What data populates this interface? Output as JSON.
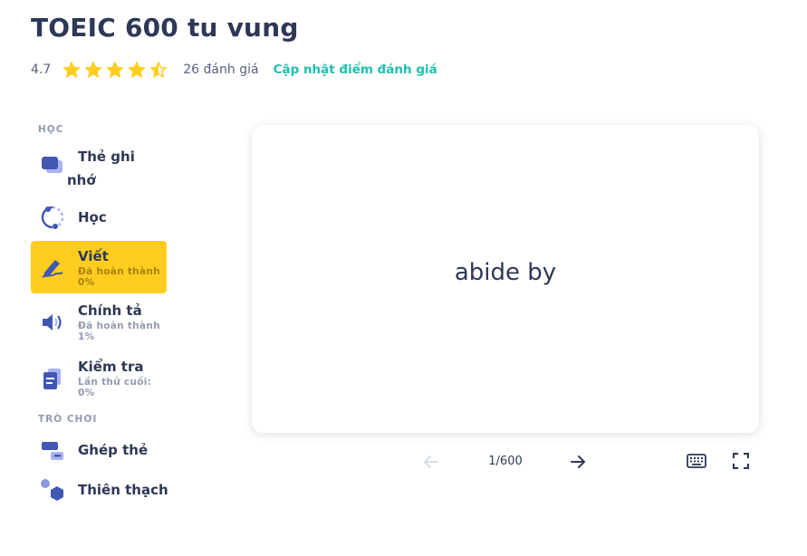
{
  "header": {
    "title": "TOEIC 600 tu vung",
    "rating_value": "4.7",
    "stars": {
      "rating": 4.5,
      "max": 5,
      "color": "#ffcd1f",
      "icon": "star-icon"
    },
    "reviews": "26 đánh giá",
    "update_rating_link": "Cập nhật điểm đánh giá"
  },
  "sidebar": {
    "study_section": "HỌC",
    "games_section": "TRÒ CHƠI",
    "items": {
      "flashcards": {
        "label_line1": "Thẻ ghi",
        "label_line2": "nhớ",
        "icon": "flashcards-icon"
      },
      "learn": {
        "label": "Học",
        "icon": "learn-icon"
      },
      "write": {
        "label": "Viết",
        "sub1": "Đã hoàn thành",
        "sub2": "0%",
        "icon": "pencil-icon",
        "active": true
      },
      "spell": {
        "label": "Chính tả",
        "sub1": "Đã hoàn thành",
        "sub2": "1%",
        "icon": "speaker-icon"
      },
      "test": {
        "label": "Kiểm tra",
        "sub1": "Lần thử cuối:",
        "sub2": "0%",
        "icon": "test-document-icon"
      },
      "match": {
        "label": "Ghép thẻ",
        "icon": "match-icon"
      },
      "gravity": {
        "label": "Thiên thạch",
        "icon": "gravity-icon"
      }
    }
  },
  "card": {
    "term": "abide by"
  },
  "controls": {
    "counter": "1/600",
    "prev_icon": "arrow-left-icon",
    "next_icon": "arrow-right-icon",
    "keyboard_icon": "keyboard-icon",
    "fullscreen_icon": "fullscreen-icon"
  },
  "colors": {
    "accent_yellow": "#ffcd1f",
    "link_teal": "#1fbfae",
    "icon_blue": "#4257b2",
    "text_dark": "#2e3856"
  }
}
